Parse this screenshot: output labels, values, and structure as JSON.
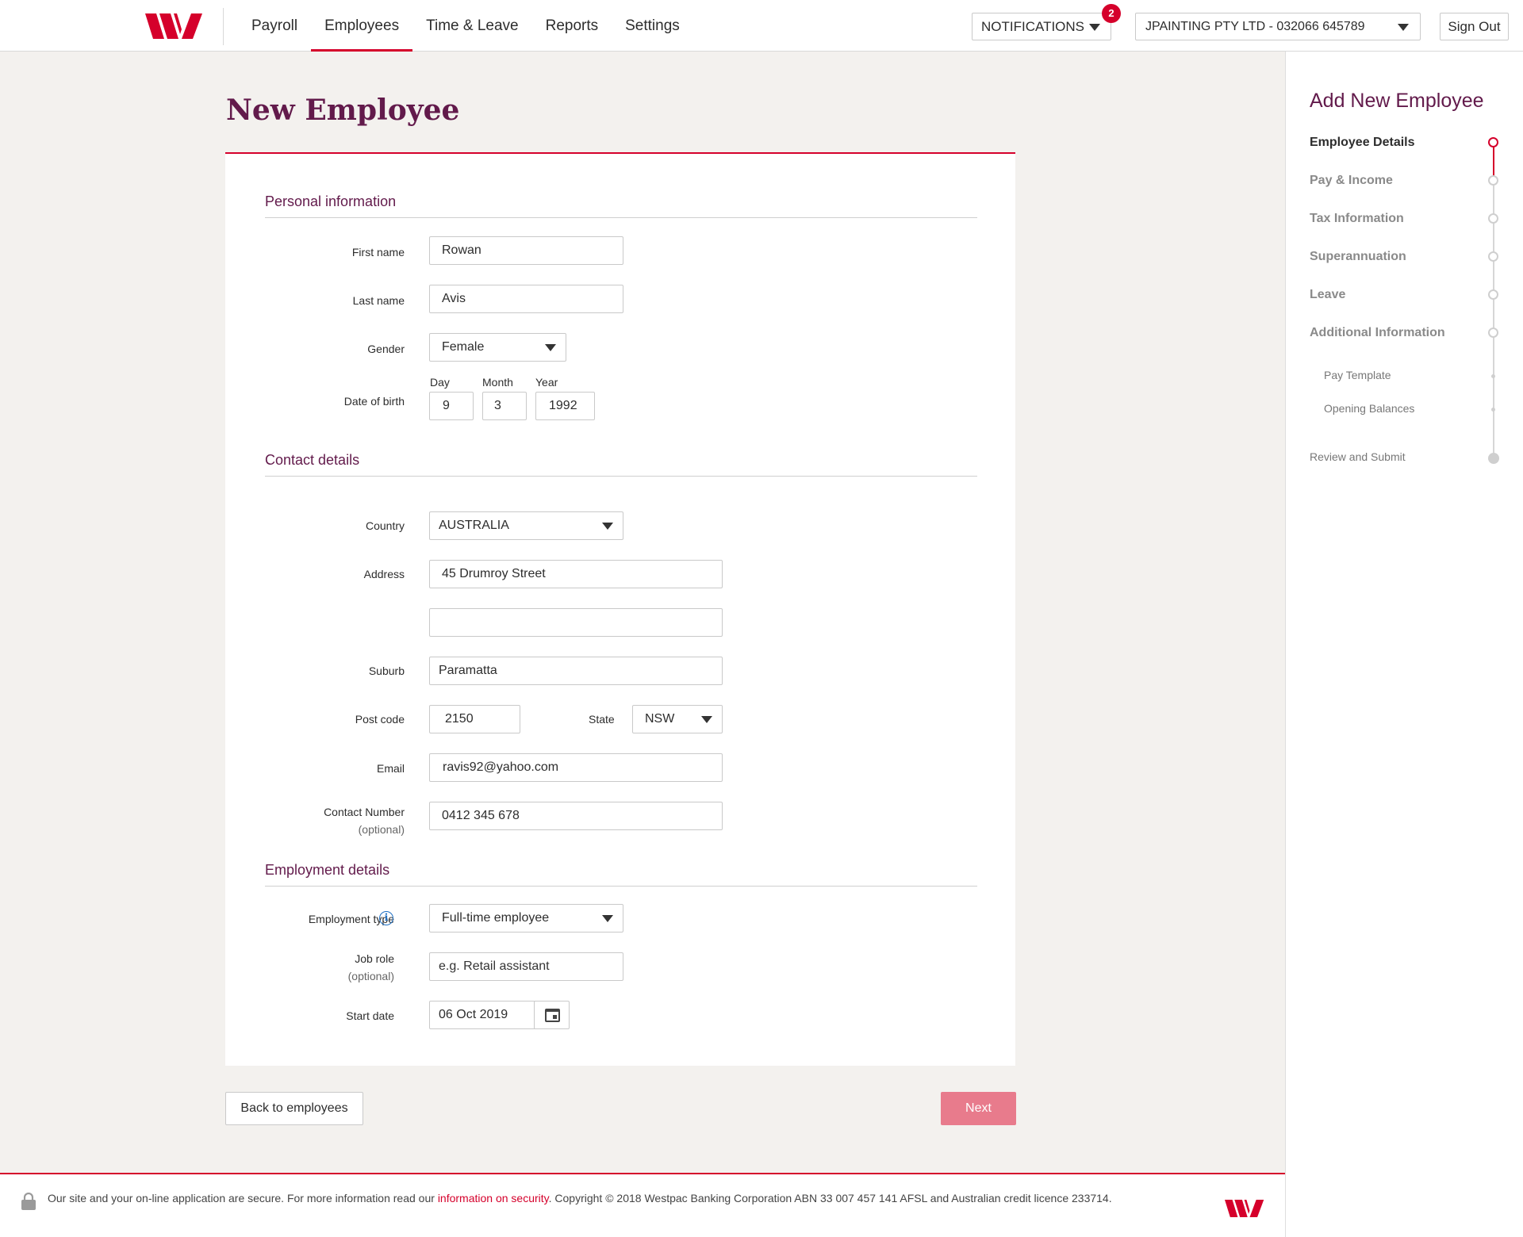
{
  "nav": {
    "items": [
      "Payroll",
      "Employees",
      "Time & Leave",
      "Reports",
      "Settings"
    ],
    "active": "Employees",
    "notifications_label": "NOTIFICATIONS",
    "notifications_count": "2",
    "org_label": "JPAINTING PTY LTD - 032066 645789",
    "signout": "Sign Out"
  },
  "page": {
    "title": "New Employee"
  },
  "form": {
    "personal": {
      "heading": "Personal information",
      "first_name_label": "First name",
      "first_name": "Rowan",
      "last_name_label": "Last name",
      "last_name": "Avis",
      "gender_label": "Gender",
      "gender": "Female",
      "dob_label": "Date of birth",
      "day_label": "Day",
      "month_label": "Month",
      "year_label": "Year",
      "day": "9",
      "month": "3",
      "year": "1992"
    },
    "contact": {
      "heading": "Contact details",
      "country_label": "Country",
      "country": "AUSTRALIA",
      "address_label": "Address",
      "address1": "45 Drumroy Street",
      "address2": "",
      "suburb_label": "Suburb",
      "suburb": "Paramatta",
      "postcode_label": "Post code",
      "postcode": "2150",
      "state_label": "State",
      "state": "NSW",
      "email_label": "Email",
      "email": "ravis92@yahoo.com",
      "phone_label": "Contact Number",
      "phone_optional": "(optional)",
      "phone": "0412 345 678"
    },
    "employment": {
      "heading": "Employment details",
      "type_label": "Employment type",
      "type": "Full-time employee",
      "role_label": "Job role",
      "role_optional": "(optional)",
      "role_placeholder": "e.g. Retail assistant",
      "start_label": "Start date",
      "start_date": "06 Oct 2019"
    }
  },
  "actions": {
    "back": "Back to employees",
    "next": "Next"
  },
  "sidebar": {
    "title": "Add New Employee",
    "steps": [
      "Employee Details",
      "Pay & Income",
      "Tax Information",
      "Superannuation",
      "Leave",
      "Additional Information"
    ],
    "substeps": [
      "Pay Template",
      "Opening Balances"
    ],
    "final": "Review and Submit"
  },
  "footer": {
    "text_before": "Our site and your on-line application are secure. For more information read our ",
    "link": "information on security",
    "text_after": ". Copyright © 2018 Westpac Banking Corporation ABN 33 007 457 141 AFSL and Australian credit licence 233714."
  },
  "colors": {
    "brand_red": "#d5002b",
    "brand_plum": "#621a4b",
    "next_disabled": "#e87b8c"
  }
}
